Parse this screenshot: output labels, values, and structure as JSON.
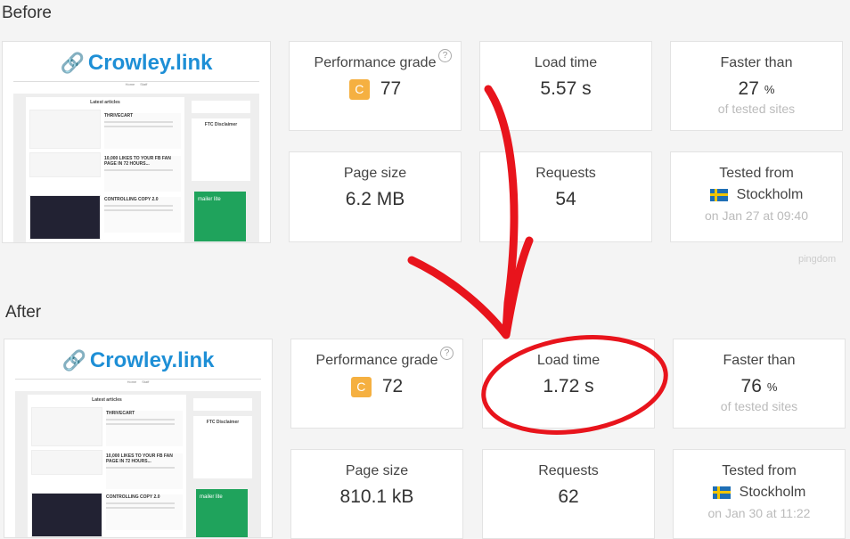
{
  "before": {
    "label": "Before",
    "performance_grade": {
      "title": "Performance grade",
      "letter": "C",
      "score": "77",
      "help": "?"
    },
    "load_time": {
      "title": "Load time",
      "value": "5.57 s"
    },
    "faster_than": {
      "title": "Faster than",
      "value": "27",
      "unit": "%",
      "sub": "of tested sites"
    },
    "page_size": {
      "title": "Page size",
      "value": "6.2 MB"
    },
    "requests": {
      "title": "Requests",
      "value": "54"
    },
    "tested_from": {
      "title": "Tested from",
      "location": "Stockholm",
      "date": "on Jan 27 at 09:40"
    }
  },
  "after": {
    "label": "After",
    "performance_grade": {
      "title": "Performance grade",
      "letter": "C",
      "score": "72",
      "help": "?"
    },
    "load_time": {
      "title": "Load time",
      "value": "1.72 s"
    },
    "faster_than": {
      "title": "Faster than",
      "value": "76",
      "unit": "%",
      "sub": "of tested sites"
    },
    "page_size": {
      "title": "Page size",
      "value": "810.1 kB"
    },
    "requests": {
      "title": "Requests",
      "value": "62"
    },
    "tested_from": {
      "title": "Tested from",
      "location": "Stockholm",
      "date": "on Jan 30 at 11:22"
    }
  },
  "thumbnail": {
    "site": "Crowley.link",
    "nav": [
      "Home",
      "Staff"
    ],
    "heading": "Latest articles",
    "articles": [
      "THRIVECART",
      "10,000 LIKES TO YOUR FB FAN PAGE IN 72 HOURS...",
      "CONTROLLING COPY 2.0"
    ],
    "sidebar_heading": "FTC Disclaimer",
    "ad": "mailer lite"
  },
  "watermark": "pingdom",
  "colors": {
    "grade": "#f5b041",
    "annotation": "#e8141c",
    "logo": "#1e8fd6"
  }
}
